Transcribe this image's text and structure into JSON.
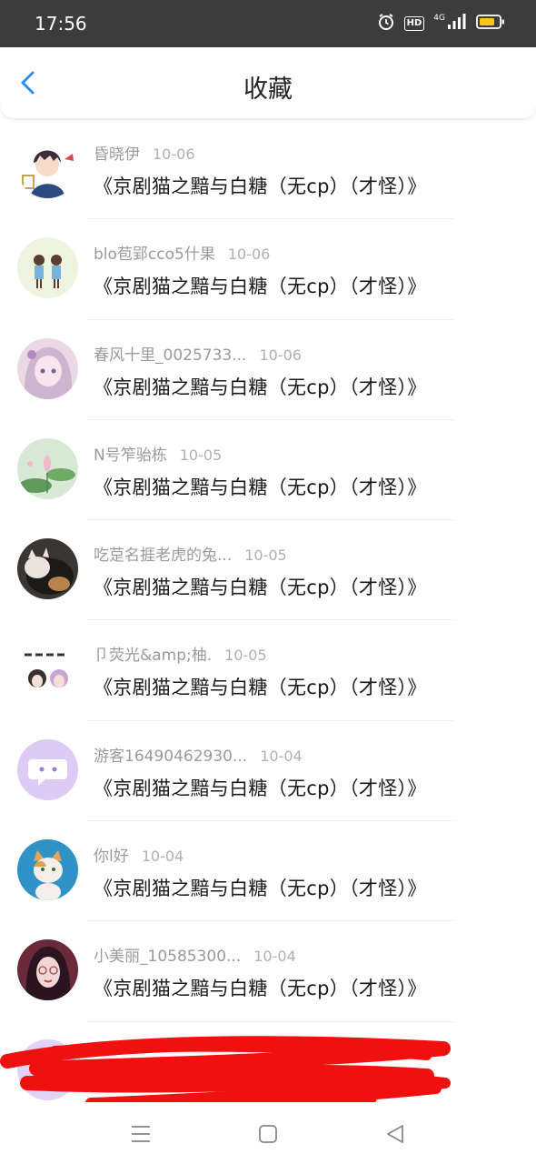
{
  "status_bar": {
    "time": "17:56",
    "hd_label": "HD",
    "network_label": "4G",
    "icons": [
      "alarm-icon",
      "hd-icon",
      "signal-icon",
      "battery-icon"
    ],
    "battery_color": "#f5c518"
  },
  "header": {
    "title": "收藏",
    "back_icon": "chevron-left-icon",
    "accent_color": "#2f8df0"
  },
  "items": [
    {
      "user": "昏晓伊",
      "date": "10-06",
      "title": "《京剧猫之黯与白糖（无cp）（才怪）》",
      "avatar": "avatar-anime-boy"
    },
    {
      "user": "blo苞郢cco5什果",
      "date": "10-06",
      "title": "《京剧猫之黯与白糖（无cp）（才怪）》",
      "avatar": "avatar-couple"
    },
    {
      "user": "春风十里_0025733...",
      "date": "10-06",
      "title": "《京剧猫之黯与白糖（无cp）（才怪）》",
      "avatar": "avatar-anime-girl"
    },
    {
      "user": "N号笮骀栋",
      "date": "10-05",
      "title": "《京剧猫之黯与白糖（无cp）（才怪）》",
      "avatar": "avatar-lotus"
    },
    {
      "user": "吃莡名捱老虎的兔...",
      "date": "10-05",
      "title": "《京剧猫之黯与白糖（无cp）（才怪）》",
      "avatar": "avatar-cat-dark"
    },
    {
      "user": "卩荧光&amp;柚.",
      "date": "10-05",
      "title": "《京剧猫之黯与白糖（无cp）（才怪）》",
      "avatar": "avatar-girl-text"
    },
    {
      "user": "游客16490462930...",
      "date": "10-04",
      "title": "《京剧猫之黯与白糖（无cp）（才怪）》",
      "avatar": "avatar-default-chat"
    },
    {
      "user": "你l好",
      "date": "10-04",
      "title": "《京剧猫之黯与白糖（无cp）（才怪）》",
      "avatar": "avatar-cat-photo"
    },
    {
      "user": "小美丽_10585300...",
      "date": "10-04",
      "title": "《京剧猫之黯与白糖（无cp）（才怪）》",
      "avatar": "avatar-girl-glasses"
    }
  ],
  "nav_bar": {
    "icons": [
      "menu-icon",
      "home-square-icon",
      "back-triangle-icon"
    ]
  }
}
